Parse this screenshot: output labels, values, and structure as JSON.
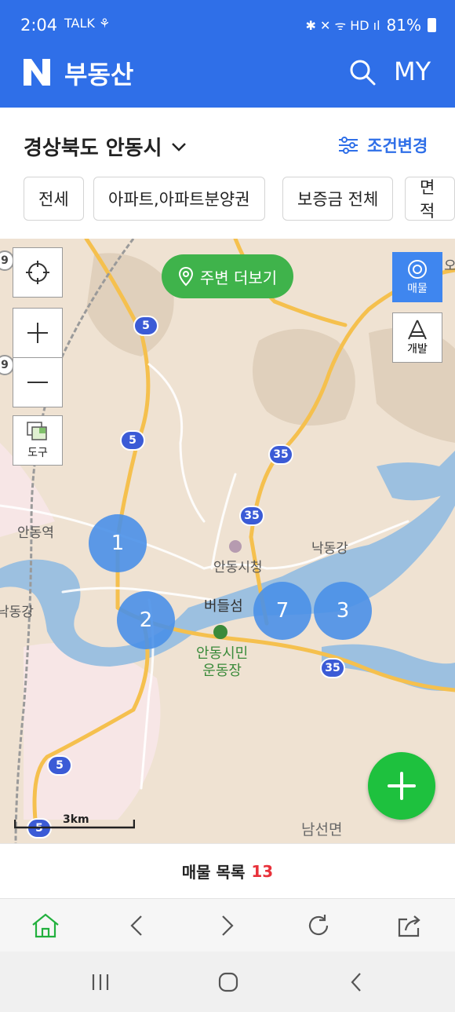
{
  "status": {
    "time": "2:04",
    "left_icons": "TALK ⚘",
    "right_icons": "✱ ✕ ᯤ HD ıl",
    "battery": "81%"
  },
  "header": {
    "logo": "N",
    "title": "부동산",
    "my_label": "MY",
    "search_icon": "search-icon"
  },
  "region": {
    "label": "경상북도 안동시",
    "condition_label": "조건변경"
  },
  "filters": [
    "전세",
    "아파트,아파트분양권",
    "보증금 전체",
    "면적"
  ],
  "map": {
    "nearby_label": "주변 더보기",
    "tools_label": "도구",
    "layer_listing_label": "매물",
    "layer_dev_label": "개발",
    "places": {
      "andong_station": "안동역",
      "nakdong_west": "낙동강",
      "nakdong_east": "낙동강",
      "city_hall": "안동시청",
      "beodeulseom": "버들섬",
      "stadium": "안동시민\n운동장",
      "namseon": "남선면",
      "o_edge": "오"
    },
    "route_numbers": {
      "r5": "5",
      "r35": "35",
      "r9": "9"
    },
    "clusters": [
      "1",
      "2",
      "7",
      "3"
    ],
    "scale_label": "3km"
  },
  "listing": {
    "label": "매물 목록",
    "count": "13"
  },
  "colors": {
    "brand_blue": "#2f6fe8",
    "green": "#3fb34b",
    "cluster": "#4a90e8",
    "count_red": "#e8313a"
  }
}
